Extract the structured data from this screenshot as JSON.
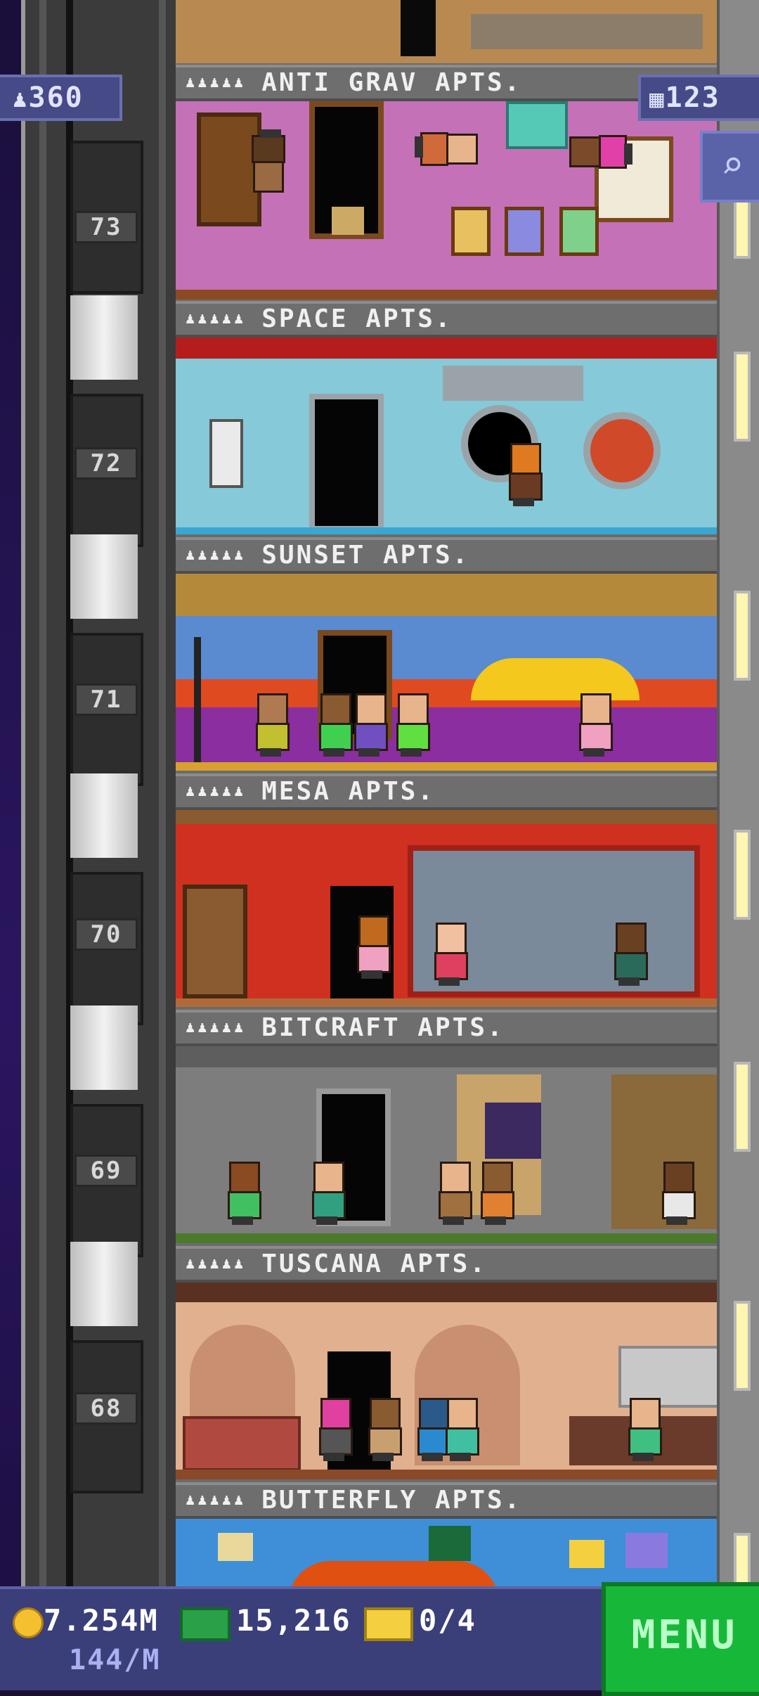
{
  "hud": {
    "population": "360",
    "floors": "123",
    "coins": "7.254M",
    "coin_rate": "144/M",
    "bux": "15,216",
    "tickets": "0/4",
    "menu_label": "MENU"
  },
  "floor_numbers": [
    "73",
    "72",
    "71",
    "70",
    "69",
    "68"
  ],
  "labels": {
    "anti_grav": "ANTI GRAV APTS.",
    "space": "SPACE APTS.",
    "sunset": "SUNSET APTS.",
    "mesa": "MESA APTS.",
    "bitcraft": "BITCRAFT APTS.",
    "tuscana": "TUSCANA APTS.",
    "butterfly": "BUTTERFLY APTS."
  },
  "stars": "♟♟♟♟♟",
  "colors": {
    "anti_grav": "#c471b7",
    "space": "#86c9d8",
    "sunset": "#8a2ea0",
    "mesa": "#d0301f",
    "bitcraft": "#7d7d7d",
    "tuscana": "#e0b08f",
    "butterfly": "#3e8fd8"
  },
  "icons": {
    "population": "person-icon",
    "floors": "building-icon",
    "search": "magnifier-icon",
    "coins": "coin-icon",
    "bux": "banknote-icon",
    "tickets": "ticket-icon"
  }
}
